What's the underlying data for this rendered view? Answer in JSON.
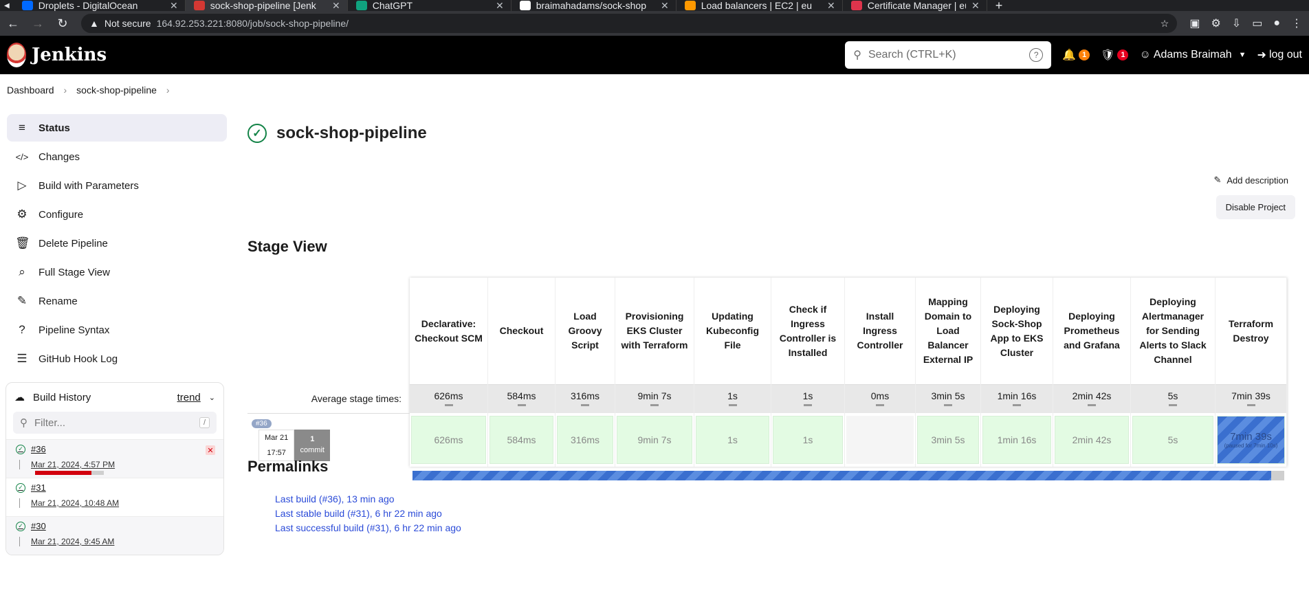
{
  "browser": {
    "tabs": [
      {
        "label": "Droplets - DigitalOcean",
        "color": "#0069ff",
        "active": false
      },
      {
        "label": "sock-shop-pipeline [Jenk",
        "color": "#d33833",
        "active": true
      },
      {
        "label": "ChatGPT",
        "color": "#10a37f",
        "active": false
      },
      {
        "label": "braimahadams/sock-shop",
        "color": "#ffffff",
        "active": false
      },
      {
        "label": "Load balancers | EC2 | eu",
        "color": "#ff9900",
        "active": false
      },
      {
        "label": "Certificate Manager | eu",
        "color": "#dd344c",
        "active": false
      }
    ],
    "not_secure": "Not secure",
    "url": "164.92.253.221:8080/job/sock-shop-pipeline/"
  },
  "header": {
    "app_name": "Jenkins",
    "search_placeholder": "Search (CTRL+K)",
    "notif_count": "1",
    "security_count": "1",
    "user": "Adams Braimah",
    "logout": "log out"
  },
  "breadcrumb": [
    "Dashboard",
    "sock-shop-pipeline"
  ],
  "sidebar": {
    "items": [
      {
        "label": "Status",
        "icon": "status-icon"
      },
      {
        "label": "Changes",
        "icon": "code-icon"
      },
      {
        "label": "Build with Parameters",
        "icon": "play-icon"
      },
      {
        "label": "Configure",
        "icon": "gear-icon"
      },
      {
        "label": "Delete Pipeline",
        "icon": "trash-icon"
      },
      {
        "label": "Full Stage View",
        "icon": "search-icon"
      },
      {
        "label": "Rename",
        "icon": "pencil-icon"
      },
      {
        "label": "Pipeline Syntax",
        "icon": "help-icon"
      },
      {
        "label": "GitHub Hook Log",
        "icon": "log-icon"
      }
    ]
  },
  "build_history": {
    "title": "Build History",
    "trend": "trend",
    "filter_placeholder": "Filter...",
    "shortcut": "/",
    "builds": [
      {
        "num": "#36",
        "date": "Mar 21, 2024, 4:57 PM",
        "progress": 0.82,
        "running": true
      },
      {
        "num": "#31",
        "date": "Mar 21, 2024, 10:48 AM",
        "running": false
      },
      {
        "num": "#30",
        "date": "Mar 21, 2024, 9:45 AM",
        "running": false
      }
    ]
  },
  "main": {
    "title": "sock-shop-pipeline",
    "add_description": "Add description",
    "disable_project": "Disable Project",
    "stage_view_title": "Stage View",
    "avg_label": "Average stage times:",
    "build": {
      "tag": "#36",
      "date": "Mar 21",
      "time": "17:57",
      "commits": "1",
      "commits_label": "commit",
      "progress": 0.985
    },
    "stages": [
      {
        "name": "Declarative: Checkout SCM",
        "avg": "626ms",
        "run": "626ms",
        "state": "done"
      },
      {
        "name": "Checkout",
        "avg": "584ms",
        "run": "584ms",
        "state": "done"
      },
      {
        "name": "Load Groovy Script",
        "avg": "316ms",
        "run": "316ms",
        "state": "done"
      },
      {
        "name": "Provisioning EKS Cluster with Terraform",
        "avg": "9min 7s",
        "run": "9min 7s",
        "state": "done"
      },
      {
        "name": "Updating Kubeconfig File",
        "avg": "1s",
        "run": "1s",
        "state": "done"
      },
      {
        "name": "Check if Ingress Controller is Installed",
        "avg": "1s",
        "run": "1s",
        "state": "done"
      },
      {
        "name": "Install Ingress Controller",
        "avg": "0ms",
        "run": "",
        "state": "empty"
      },
      {
        "name": "Mapping Domain to Load Balancer External IP",
        "avg": "3min 5s",
        "run": "3min 5s",
        "state": "done"
      },
      {
        "name": "Deploying Sock-Shop App to EKS Cluster",
        "avg": "1min 16s",
        "run": "1min 16s",
        "state": "done"
      },
      {
        "name": "Deploying Prometheus and Grafana",
        "avg": "2min 42s",
        "run": "2min 42s",
        "state": "done"
      },
      {
        "name": "Deploying Alertmanager for Sending Alerts to Slack Channel",
        "avg": "5s",
        "run": "5s",
        "state": "done"
      },
      {
        "name": "Terraform Destroy",
        "avg": "7min 39s",
        "run": "7min 39s",
        "sub": "(paused for 7min 10s)",
        "state": "running"
      }
    ],
    "permalinks_title": "Permalinks",
    "permalinks": [
      "Last build (#36), 13 min ago",
      "Last stable build (#31), 6 hr 22 min ago",
      "Last successful build (#31), 6 hr 22 min ago"
    ]
  }
}
